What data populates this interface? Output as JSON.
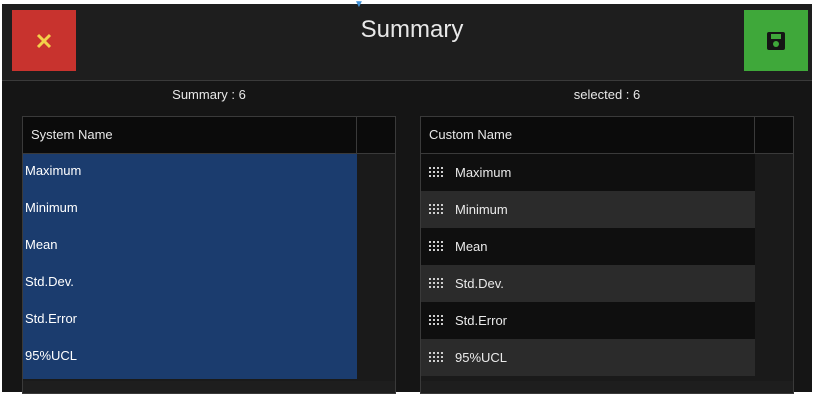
{
  "header": {
    "title": "Summary",
    "close_icon": "close-icon",
    "save_icon": "floppy-disk-icon",
    "colors": {
      "close": "#c8332e",
      "save": "#3fa83a",
      "selection": "#1b3c6e"
    }
  },
  "left_panel": {
    "count_label": "Summary : 6",
    "column_header": "System Name",
    "items": [
      {
        "label": "Maximum"
      },
      {
        "label": "Minimum"
      },
      {
        "label": "Mean"
      },
      {
        "label": "Std.Dev."
      },
      {
        "label": "Std.Error"
      },
      {
        "label": "95%UCL"
      }
    ]
  },
  "right_panel": {
    "count_label": "selected : 6",
    "column_header": "Custom Name",
    "items": [
      {
        "label": "Maximum"
      },
      {
        "label": "Minimum"
      },
      {
        "label": "Mean"
      },
      {
        "label": "Std.Dev."
      },
      {
        "label": "Std.Error"
      },
      {
        "label": "95%UCL"
      }
    ]
  }
}
